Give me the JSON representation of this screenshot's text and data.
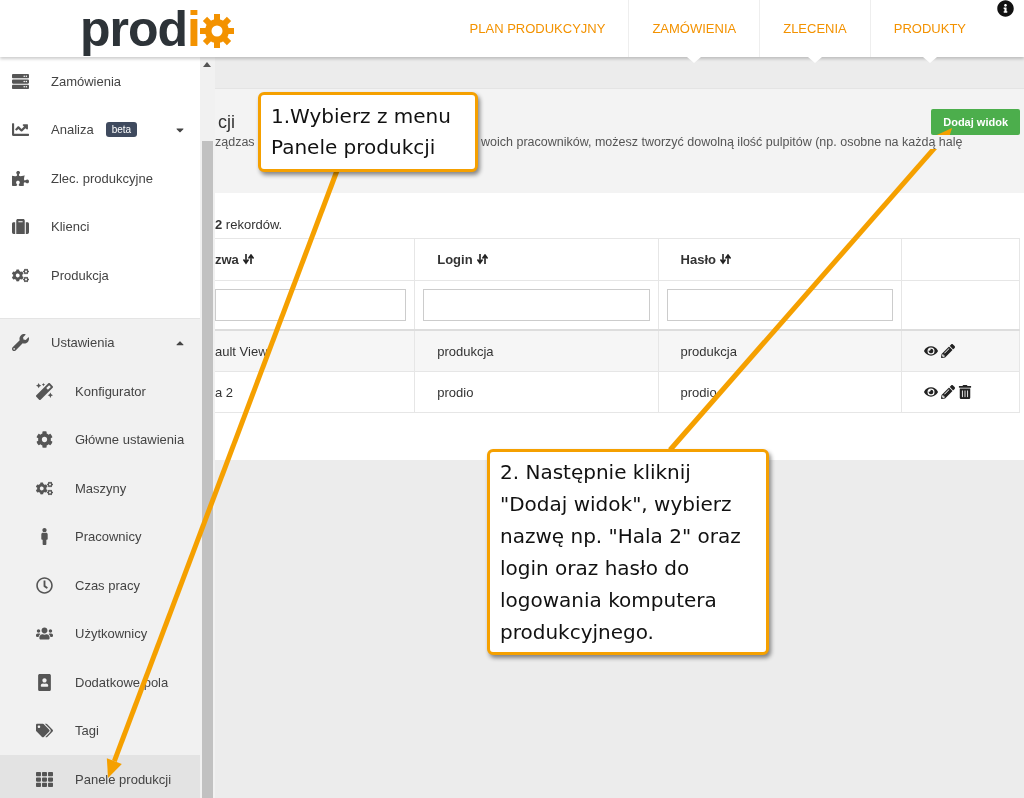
{
  "header": {
    "logo": {
      "dark": "prod",
      "accent": "i"
    },
    "nav": [
      {
        "label": "PLAN PRODUKCYJNY",
        "dropdown": false
      },
      {
        "label": "ZAMÓWIENIA",
        "dropdown": true
      },
      {
        "label": "ZLECENIA",
        "dropdown": true
      },
      {
        "label": "PRODUKTY",
        "dropdown": true
      }
    ]
  },
  "sidebar": {
    "items": [
      {
        "label": "Zamówienia",
        "selected": false
      },
      {
        "label": "Analiza",
        "badge": "beta",
        "expanded": false,
        "selected": false
      },
      {
        "label": "Zlec. produkcyjne",
        "selected": false
      },
      {
        "label": "Klienci",
        "selected": false
      },
      {
        "label": "Produkcja",
        "selected": false
      },
      {
        "label": "Ustawienia",
        "expanded": true,
        "selected": false,
        "children": [
          {
            "label": "Konfigurator",
            "selected": false
          },
          {
            "label": "Główne ustawienia",
            "selected": false
          },
          {
            "label": "Maszyny",
            "selected": false
          },
          {
            "label": "Pracownicy",
            "selected": false
          },
          {
            "label": "Czas pracy",
            "selected": false
          },
          {
            "label": "Użytkownicy",
            "selected": false
          },
          {
            "label": "Dodatkowe pola",
            "selected": false
          },
          {
            "label": "Tagi",
            "selected": false
          },
          {
            "label": "Panele produkcji",
            "selected": true
          }
        ]
      }
    ]
  },
  "panel": {
    "title": "cji",
    "description": [
      "ządzas",
      "woich pracowników, możesz tworzyć dowolną ilość pulpitów (np. osobne na każdą halę"
    ],
    "add_button": "Dodaj widok"
  },
  "table": {
    "summary": "**2** rekordów.",
    "columns": [
      "zwa",
      "Login",
      "Hasło"
    ],
    "rows": [
      {
        "cells": [
          "ault View",
          "produkcja",
          "produkcja"
        ],
        "deletable": false
      },
      {
        "cells": [
          "a 2",
          "prodio",
          "prodio"
        ],
        "deletable": true
      }
    ]
  },
  "callouts": [
    {
      "text": "1.Wybierz z menu Panele produkcji"
    },
    {
      "text": "2. Następnie kliknij \"Dodaj widok\", wybierz nazwę np. \"Hala 2\" oraz login oraz hasło do logowania komputera produkcyjnego."
    }
  ]
}
